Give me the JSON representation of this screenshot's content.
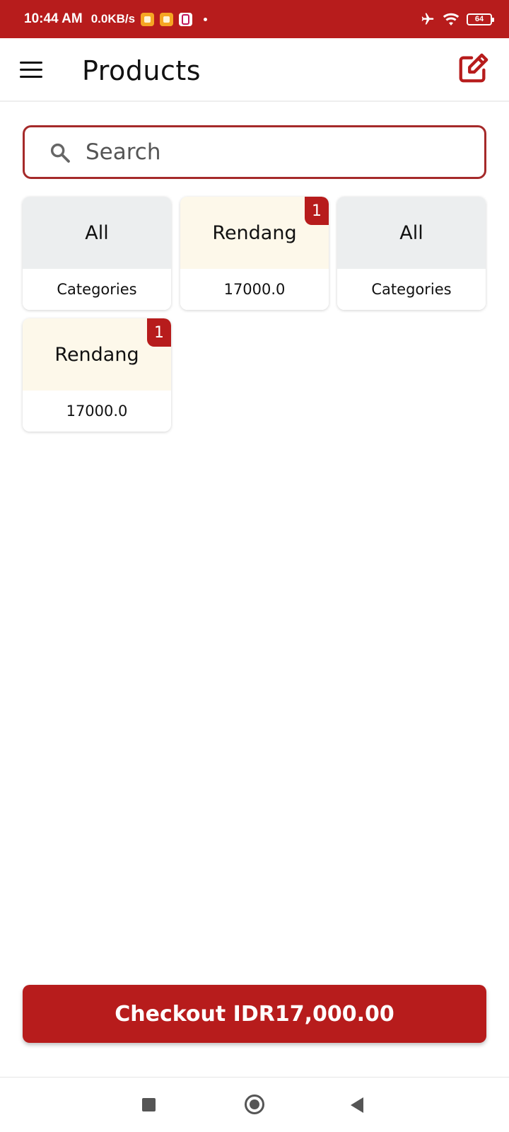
{
  "status_bar": {
    "time": "10:44 AM",
    "net_speed": "0.0KB/s",
    "battery": "64"
  },
  "header": {
    "title": "Products",
    "menu_icon": "hamburger-menu-icon",
    "action_icon": "edit-square-icon"
  },
  "search": {
    "placeholder": "Search",
    "value": ""
  },
  "products": [
    {
      "top": "All",
      "bottom": "Categories",
      "badge": ""
    },
    {
      "top": "Rendang",
      "bottom": "17000.0",
      "badge": "1"
    },
    {
      "top": "All",
      "bottom": "Categories",
      "badge": ""
    },
    {
      "top": "Rendang",
      "bottom": "17000.0",
      "badge": "1"
    }
  ],
  "checkout": {
    "label": "Checkout IDR17,000.00"
  },
  "colors": {
    "primary": "#b71c1c",
    "card_grey": "#eceeef",
    "card_cream": "#fdf8ea"
  },
  "nav": {
    "icons": [
      "recent-apps-icon",
      "home-icon",
      "back-icon"
    ]
  }
}
